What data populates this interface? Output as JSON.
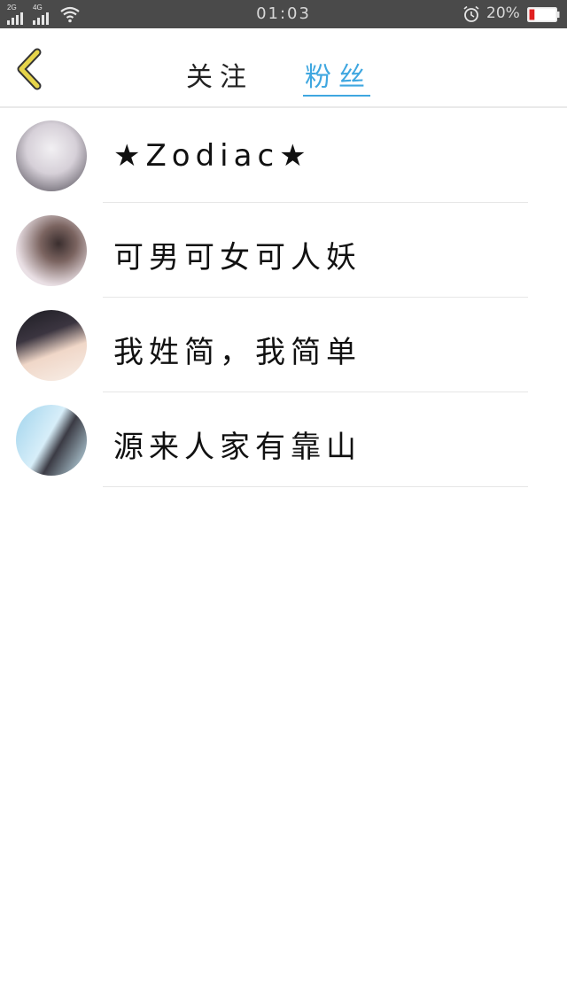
{
  "status_bar": {
    "sim1_label": "2G",
    "sim2_label": "4G",
    "time": "01:03",
    "battery_percent": "20%",
    "battery_level": 0.2,
    "battery_color": "#e02020"
  },
  "header": {
    "back_icon": "chevron-left-icon",
    "back_color": "#e6d44a",
    "tabs": [
      {
        "label": "关注",
        "active": false
      },
      {
        "label": "粉丝",
        "active": true
      }
    ],
    "active_color": "#3fa7e0"
  },
  "fans": [
    {
      "name": "★Zodiac★"
    },
    {
      "name": "可男可女可人妖"
    },
    {
      "name": "我姓简，我简单"
    },
    {
      "name": "源来人家有靠山"
    }
  ]
}
